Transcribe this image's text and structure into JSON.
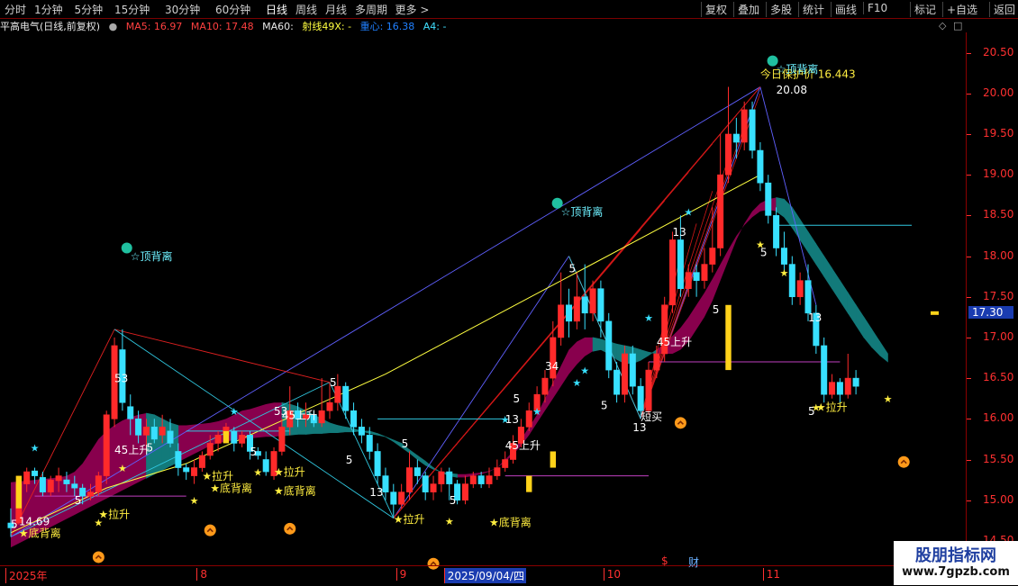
{
  "toolbar": {
    "periods": [
      "分时",
      "1分钟",
      "5分钟",
      "15分钟",
      "30分钟",
      "60分钟",
      "日线",
      "周线",
      "月线",
      "多周期",
      "更多 >"
    ],
    "active_period": "日线",
    "right_buttons": [
      "复权",
      "叠加",
      "多股",
      "统计",
      "画线",
      "F10",
      "标记",
      "+自选",
      "返回"
    ]
  },
  "header": {
    "stock_title": "平高电气(日线,前复权)",
    "ma5": "MA5: 16.97",
    "ma10": "MA10: 17.48",
    "ma60": "MA60:",
    "shexian": "射线49X: -",
    "zhongxin": "重心: 16.38",
    "a4": "A4: -"
  },
  "colors": {
    "up": "#ff2a2a",
    "down": "#38e0ff",
    "ma_band": "#a0005a",
    "ma_band2": "#127a7a",
    "yellow": "#ffff40",
    "axis": "#ff3030",
    "current_price_bg": "#1a3cb0"
  },
  "chart_data": {
    "type": "candlestick",
    "title": "平高电气(日线,前复权)",
    "ylim": [
      14.2,
      20.75
    ],
    "y_ticks": [
      "20.50",
      "20.00",
      "19.50",
      "19.00",
      "18.50",
      "18.00",
      "17.50",
      "17.00",
      "16.50",
      "16.00",
      "15.50",
      "15.00",
      "14.50"
    ],
    "current_price": "17.30",
    "x_labels": [
      "2025年",
      "8",
      "9",
      "2025/09/04/四",
      "10",
      "11"
    ],
    "x_label_days": [
      0,
      24,
      49,
      55,
      75,
      95
    ],
    "event_markers": [
      "$",
      "财"
    ],
    "ohlc": [
      [
        14.72,
        14.66,
        14.55,
        14.9
      ],
      [
        14.72,
        15.2,
        14.7,
        15.3
      ],
      [
        15.2,
        15.35,
        15.1,
        15.4
      ],
      [
        15.36,
        15.3,
        15.2,
        15.4
      ],
      [
        15.28,
        15.1,
        15.05,
        15.35
      ],
      [
        15.1,
        15.25,
        15.05,
        15.3
      ],
      [
        15.24,
        15.3,
        15.1,
        15.4
      ],
      [
        15.25,
        15.2,
        15.1,
        15.35
      ],
      [
        15.2,
        15.15,
        15.05,
        15.3
      ],
      [
        15.15,
        15.05,
        14.95,
        15.2
      ],
      [
        15.05,
        15.1,
        15.0,
        15.2
      ],
      [
        15.1,
        15.3,
        15.05,
        15.35
      ],
      [
        15.3,
        16.05,
        15.2,
        16.1
      ],
      [
        16.0,
        16.9,
        15.9,
        17.0
      ],
      [
        16.85,
        16.2,
        16.1,
        17.1
      ],
      [
        16.15,
        16.0,
        15.8,
        16.3
      ],
      [
        16.0,
        15.8,
        15.7,
        16.1
      ],
      [
        15.8,
        15.9,
        15.6,
        16.0
      ],
      [
        15.9,
        15.75,
        15.7,
        16.0
      ],
      [
        15.8,
        15.9,
        15.7,
        16.05
      ],
      [
        15.85,
        15.7,
        15.65,
        16.0
      ],
      [
        15.6,
        15.4,
        15.3,
        15.7
      ],
      [
        15.4,
        15.35,
        15.25,
        15.45
      ],
      [
        15.3,
        15.4,
        15.2,
        15.5
      ],
      [
        15.4,
        15.55,
        15.35,
        15.6
      ],
      [
        15.55,
        15.7,
        15.5,
        15.8
      ],
      [
        15.7,
        15.8,
        15.6,
        15.85
      ],
      [
        15.8,
        15.9,
        15.7,
        15.95
      ],
      [
        15.85,
        15.7,
        15.6,
        15.9
      ],
      [
        15.7,
        15.8,
        15.65,
        15.85
      ],
      [
        15.8,
        15.6,
        15.5,
        15.85
      ],
      [
        15.6,
        15.55,
        15.5,
        15.65
      ],
      [
        15.5,
        15.35,
        15.3,
        15.6
      ],
      [
        15.3,
        15.6,
        15.25,
        15.65
      ],
      [
        15.6,
        15.9,
        15.55,
        16.0
      ],
      [
        15.9,
        16.1,
        15.8,
        16.4
      ],
      [
        16.1,
        16.0,
        15.9,
        16.2
      ],
      [
        16.0,
        16.05,
        15.9,
        16.2
      ],
      [
        16.05,
        15.95,
        15.9,
        16.1
      ],
      [
        15.95,
        16.1,
        15.9,
        16.5
      ],
      [
        16.1,
        16.2,
        16.0,
        16.45
      ],
      [
        16.2,
        16.4,
        16.1,
        16.55
      ],
      [
        16.4,
        16.1,
        16.0,
        16.45
      ],
      [
        16.1,
        15.9,
        15.8,
        16.2
      ],
      [
        15.9,
        15.8,
        15.7,
        16.0
      ],
      [
        15.8,
        15.6,
        15.5,
        15.9
      ],
      [
        15.6,
        15.3,
        15.2,
        15.7
      ],
      [
        15.3,
        15.1,
        15.0,
        15.4
      ],
      [
        15.1,
        14.95,
        14.78,
        15.2
      ],
      [
        14.95,
        15.1,
        14.9,
        15.2
      ],
      [
        15.1,
        15.4,
        15.0,
        15.6
      ],
      [
        15.4,
        15.3,
        15.2,
        15.5
      ],
      [
        15.3,
        15.1,
        15.0,
        15.35
      ],
      [
        15.1,
        15.2,
        15.0,
        15.3
      ],
      [
        15.2,
        15.35,
        15.1,
        15.4
      ],
      [
        15.35,
        15.2,
        15.0,
        15.4
      ],
      [
        15.2,
        15.0,
        14.95,
        15.25
      ],
      [
        15.0,
        15.2,
        14.95,
        15.3
      ],
      [
        15.2,
        15.3,
        15.15,
        15.35
      ],
      [
        15.3,
        15.2,
        15.15,
        15.35
      ],
      [
        15.2,
        15.3,
        15.15,
        15.4
      ],
      [
        15.3,
        15.4,
        15.25,
        15.5
      ],
      [
        15.4,
        15.5,
        15.35,
        15.6
      ],
      [
        15.5,
        15.7,
        15.45,
        15.8
      ],
      [
        15.7,
        15.9,
        15.65,
        16.0
      ],
      [
        15.9,
        16.1,
        15.85,
        16.2
      ],
      [
        16.1,
        16.3,
        16.05,
        16.4
      ],
      [
        16.3,
        16.5,
        16.2,
        16.6
      ],
      [
        16.5,
        17.0,
        16.4,
        17.2
      ],
      [
        17.0,
        17.4,
        16.9,
        17.8
      ],
      [
        17.4,
        17.2,
        17.0,
        17.6
      ],
      [
        17.2,
        17.5,
        17.1,
        17.8
      ],
      [
        17.5,
        17.3,
        17.1,
        17.9
      ],
      [
        17.3,
        17.6,
        17.2,
        17.7
      ],
      [
        17.6,
        17.2,
        17.0,
        17.7
      ],
      [
        17.2,
        16.6,
        16.5,
        17.3
      ],
      [
        16.6,
        16.3,
        16.2,
        16.7
      ],
      [
        16.3,
        16.8,
        16.2,
        16.9
      ],
      [
        16.8,
        16.4,
        16.3,
        16.9
      ],
      [
        16.4,
        16.1,
        16.0,
        16.5
      ],
      [
        16.1,
        16.6,
        16.05,
        16.7
      ],
      [
        16.6,
        16.8,
        16.5,
        16.9
      ],
      [
        16.8,
        17.4,
        16.7,
        17.5
      ],
      [
        17.4,
        18.2,
        17.3,
        18.3
      ],
      [
        18.2,
        17.6,
        17.5,
        18.5
      ],
      [
        17.6,
        17.8,
        17.5,
        17.9
      ],
      [
        17.8,
        17.7,
        17.5,
        17.9
      ],
      [
        17.7,
        17.9,
        17.6,
        18.1
      ],
      [
        17.9,
        18.1,
        17.8,
        18.6
      ],
      [
        18.1,
        19.0,
        18.0,
        19.5
      ],
      [
        19.0,
        19.5,
        18.9,
        20.08
      ],
      [
        19.5,
        19.4,
        19.2,
        19.7
      ],
      [
        19.4,
        19.8,
        19.3,
        19.9
      ],
      [
        19.8,
        19.3,
        19.2,
        19.9
      ],
      [
        19.3,
        18.9,
        18.8,
        19.4
      ],
      [
        18.9,
        18.5,
        18.4,
        19.0
      ],
      [
        18.5,
        18.1,
        18.0,
        18.6
      ],
      [
        18.1,
        17.9,
        17.8,
        18.3
      ],
      [
        17.9,
        17.5,
        17.4,
        18.0
      ],
      [
        17.5,
        17.7,
        17.4,
        17.8
      ],
      [
        17.7,
        17.3,
        17.2,
        17.9
      ],
      [
        17.3,
        16.9,
        16.8,
        17.4
      ],
      [
        16.9,
        16.3,
        16.2,
        17.0
      ],
      [
        16.3,
        16.45,
        16.25,
        16.55
      ],
      [
        16.45,
        16.3,
        16.2,
        16.5
      ],
      [
        16.3,
        16.5,
        16.25,
        16.8
      ],
      [
        16.5,
        16.4,
        16.3,
        16.6
      ]
    ],
    "band_upper": [
      15.22,
      15.23,
      15.24,
      15.25,
      15.26,
      15.27,
      15.28,
      15.3,
      15.35,
      15.45,
      15.6,
      15.75,
      15.85,
      15.92,
      15.98,
      16.02,
      16.05,
      16.07,
      16.05,
      16.0,
      15.95,
      15.92,
      15.92,
      15.93,
      15.94,
      15.95,
      15.97,
      16.0,
      16.05,
      16.1,
      16.12,
      16.15,
      16.18,
      16.2,
      16.2,
      16.18,
      16.15,
      16.1,
      16.05,
      16.0,
      15.95,
      15.92,
      15.9,
      15.88,
      15.85,
      15.82,
      15.8,
      15.78,
      15.74,
      15.7,
      15.62,
      15.55,
      15.48,
      15.4,
      15.34,
      15.3,
      15.28,
      15.28,
      15.3,
      15.32,
      15.35,
      15.4,
      15.5,
      15.6,
      15.75,
      15.9,
      16.05,
      16.25,
      16.45,
      16.65,
      16.85,
      16.95,
      17.0,
      17.0,
      16.98,
      16.95,
      16.92,
      16.9,
      16.88,
      16.85,
      16.82,
      16.8,
      16.8,
      16.8,
      16.85,
      16.95,
      17.1,
      17.25,
      17.45,
      17.7,
      17.95,
      18.2,
      18.4,
      18.55,
      18.65,
      18.7,
      18.72,
      18.7,
      18.6,
      18.45,
      18.3,
      18.15,
      18.0,
      17.85,
      17.7,
      17.55,
      17.4,
      17.25,
      17.1,
      16.95,
      16.8
    ],
    "band_lower": [
      14.42,
      14.47,
      14.52,
      14.57,
      14.62,
      14.67,
      14.72,
      14.77,
      14.82,
      14.87,
      14.92,
      14.97,
      15.02,
      15.07,
      15.12,
      15.17,
      15.22,
      15.27,
      15.32,
      15.37,
      15.42,
      15.47,
      15.52,
      15.57,
      15.62,
      15.67,
      15.7,
      15.72,
      15.74,
      15.75,
      15.76,
      15.77,
      15.78,
      15.78,
      15.79,
      15.8,
      15.81,
      15.81,
      15.82,
      15.82,
      15.83,
      15.83,
      15.84,
      15.84,
      15.85,
      15.85,
      15.82,
      15.78,
      15.72,
      15.65,
      15.58,
      15.5,
      15.43,
      15.38,
      15.35,
      15.33,
      15.32,
      15.32,
      15.33,
      15.34,
      15.36,
      15.4,
      15.47,
      15.56,
      15.67,
      15.8,
      15.95,
      16.1,
      16.25,
      16.4,
      16.55,
      16.67,
      16.77,
      16.83,
      16.85,
      16.8,
      16.73,
      16.68,
      16.68,
      16.72,
      16.78,
      16.85,
      16.93,
      17.02,
      17.12,
      17.25,
      17.4,
      17.55,
      17.72,
      17.9,
      18.08,
      18.25,
      18.38,
      18.48,
      18.55,
      18.57,
      18.55,
      18.48,
      18.35,
      18.2,
      18.05,
      17.9,
      17.75,
      17.6,
      17.45,
      17.3,
      17.15,
      17.0,
      16.88,
      16.78,
      16.7
    ],
    "yellow_line_points": [
      [
        0,
        14.6
      ],
      [
        12,
        15.15
      ],
      [
        22,
        15.45
      ],
      [
        47,
        16.55
      ],
      [
        94,
        19.0
      ]
    ],
    "annotations": [
      {
        "text": "今日保护价 16.443",
        "day": 94,
        "price": 20.19
      },
      {
        "text": "20.08",
        "day": 96,
        "price": 20.0
      },
      {
        "text": "14.69",
        "day": 1,
        "price": 14.69
      },
      {
        "text": "☆顶背离",
        "day": 15,
        "price": 17.95
      },
      {
        "text": "☆顶背离",
        "day": 69,
        "price": 18.5
      },
      {
        "text": "☆顶背离",
        "day": 96,
        "price": 20.25
      },
      {
        "text": "★底背离",
        "day": 1,
        "price": 14.55
      },
      {
        "text": "★底背离",
        "day": 25,
        "price": 15.1
      },
      {
        "text": "★底背离",
        "day": 33,
        "price": 15.07
      },
      {
        "text": "★底背离",
        "day": 60,
        "price": 14.68
      },
      {
        "text": "★拉升",
        "day": 11,
        "price": 14.78
      },
      {
        "text": "★拉升",
        "day": 24,
        "price": 15.25
      },
      {
        "text": "★拉升",
        "day": 33,
        "price": 15.3
      },
      {
        "text": "★拉升",
        "day": 48,
        "price": 14.72
      },
      {
        "text": "★拉升",
        "day": 101,
        "price": 16.1
      },
      {
        "text": "45上升",
        "day": 13,
        "price": 15.57
      },
      {
        "text": "45上升",
        "day": 34,
        "price": 16.0
      },
      {
        "text": "45上升",
        "day": 62,
        "price": 15.63
      },
      {
        "text": "45上升",
        "day": 81,
        "price": 16.9
      },
      {
        "text": "短买",
        "day": 79,
        "price": 15.98
      },
      {
        "text": "53",
        "day": 13,
        "price": 16.45
      },
      {
        "text": "53",
        "day": 33,
        "price": 16.05
      },
      {
        "text": "34",
        "day": 67,
        "price": 16.6
      },
      {
        "text": "13",
        "day": 45,
        "price": 15.05
      },
      {
        "text": "13",
        "day": 62,
        "price": 15.95
      },
      {
        "text": "13",
        "day": 78,
        "price": 15.85
      },
      {
        "text": "13",
        "day": 83,
        "price": 18.25
      },
      {
        "text": "13",
        "day": 100,
        "price": 17.2
      },
      {
        "text": "5",
        "day": 0,
        "price": 14.66
      },
      {
        "text": "5",
        "day": 8,
        "price": 14.95
      },
      {
        "text": "5",
        "day": 17,
        "price": 15.6
      },
      {
        "text": "5",
        "day": 30,
        "price": 15.55
      },
      {
        "text": "5",
        "day": 40,
        "price": 16.4
      },
      {
        "text": "5",
        "day": 42,
        "price": 15.45
      },
      {
        "text": "5",
        "day": 49,
        "price": 15.65
      },
      {
        "text": "5",
        "day": 55,
        "price": 14.95
      },
      {
        "text": "5",
        "day": 63,
        "price": 16.2
      },
      {
        "text": "5",
        "day": 70,
        "price": 17.8
      },
      {
        "text": "5",
        "day": 74,
        "price": 16.12
      },
      {
        "text": "5",
        "day": 88,
        "price": 17.3
      },
      {
        "text": "5",
        "day": 94,
        "price": 18.0
      },
      {
        "text": "5",
        "day": 100,
        "price": 16.05
      }
    ]
  },
  "watermark": {
    "title": "股朋指标网",
    "url": "www.7gpzb.com"
  }
}
